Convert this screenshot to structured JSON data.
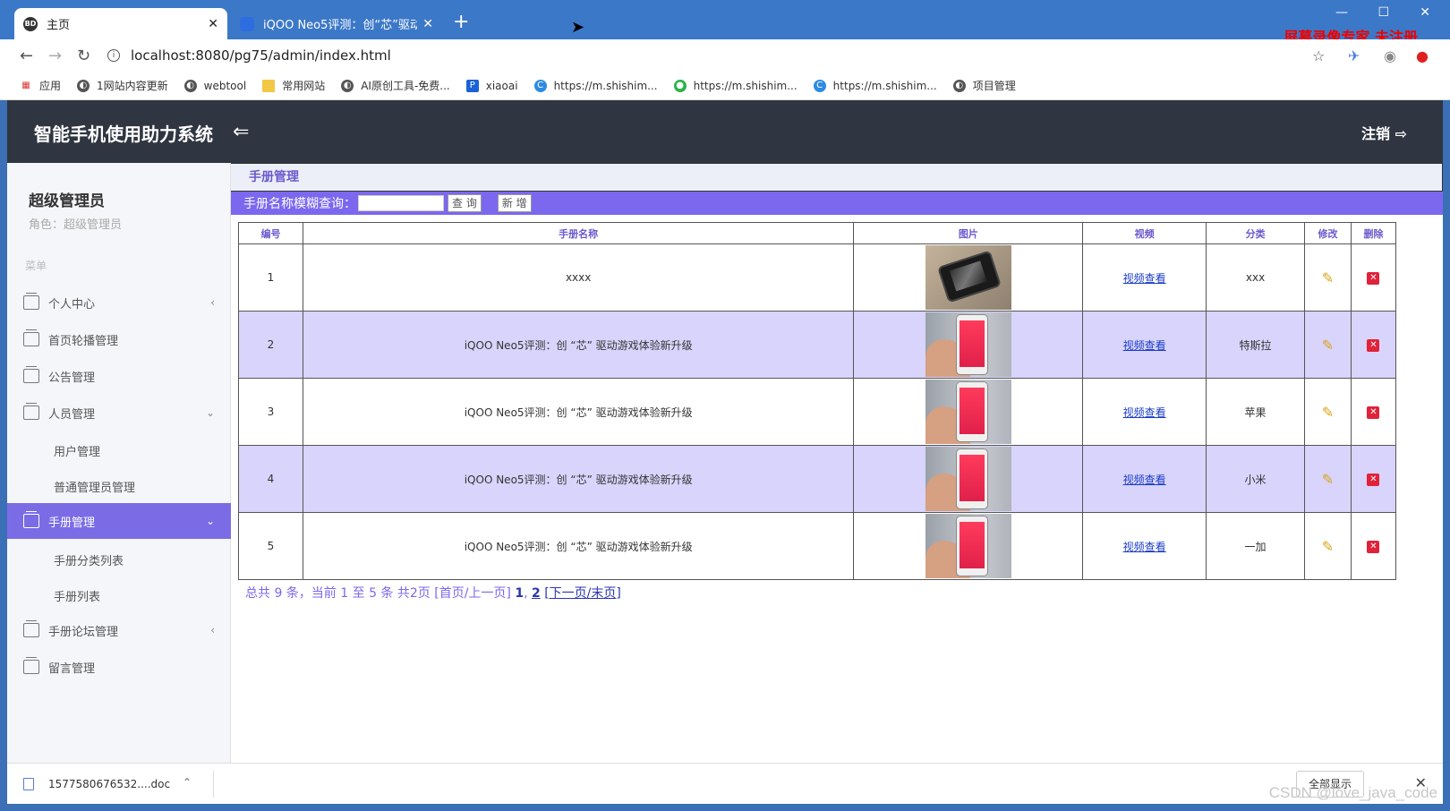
{
  "browser": {
    "tabs": [
      {
        "title": "主页",
        "favicon": "BD"
      },
      {
        "title": "iQOO Neo5评测：创“芯”驱动游..."
      }
    ],
    "url": "localhost:8080/pg75/admin/index.html",
    "watermark": "屏幕录像专家  未注册",
    "bookmarks": [
      {
        "label": "应用",
        "icon": "apps-grid-icon"
      },
      {
        "label": "1网站内容更新",
        "icon": "globe-icon"
      },
      {
        "label": "webtool",
        "icon": "globe-icon"
      },
      {
        "label": "常用网站",
        "icon": "folder-icon"
      },
      {
        "label": "AI原创工具-免费...",
        "icon": "globe-icon"
      },
      {
        "label": "xiaoai",
        "icon": "p-logo-icon"
      },
      {
        "label": "https://m.shishim...",
        "icon": "c-logo-icon"
      },
      {
        "label": "https://m.shishim...",
        "icon": "wechat-icon"
      },
      {
        "label": "https://m.shishim...",
        "icon": "c-logo-icon"
      },
      {
        "label": "项目管理",
        "icon": "globe-icon"
      }
    ]
  },
  "app": {
    "title": "智能手机使用助力系统",
    "logout": "注销"
  },
  "sidebar": {
    "user": "超级管理员",
    "role": "角色：超级管理员",
    "menu_heading": "菜单",
    "items": [
      {
        "label": "个人中心",
        "arrow": "‹"
      },
      {
        "label": "首页轮播管理"
      },
      {
        "label": "公告管理"
      },
      {
        "label": "人员管理",
        "arrow": "⌄"
      },
      {
        "label": "手册管理",
        "arrow": "⌄"
      },
      {
        "label": "手册论坛管理",
        "arrow": "‹"
      },
      {
        "label": "留言管理"
      }
    ],
    "sub_personnel": [
      "用户管理",
      "普通管理员管理"
    ],
    "sub_manual": [
      "手册分类列表",
      "手册列表"
    ]
  },
  "content": {
    "breadcrumb": "手册管理",
    "search_label": "手册名称模糊查询：",
    "search_value": "",
    "query_btn": "查 询",
    "add_btn": "新 增",
    "columns": [
      "编号",
      "手册名称",
      "图片",
      "视频",
      "分类",
      "修改",
      "删除"
    ],
    "rows": [
      {
        "id": "1",
        "name": "xxxx",
        "video": "视频查看",
        "category": "xxx",
        "image": "dark-phone"
      },
      {
        "id": "2",
        "name": "iQOO Neo5评测：创 “芯” 驱动游戏体验新升级",
        "video": "视频查看",
        "category": "特斯拉",
        "image": "red-phone"
      },
      {
        "id": "3",
        "name": "iQOO Neo5评测：创 “芯” 驱动游戏体验新升级",
        "video": "视频查看",
        "category": "苹果",
        "image": "red-phone"
      },
      {
        "id": "4",
        "name": "iQOO Neo5评测：创 “芯” 驱动游戏体验新升级",
        "video": "视频查看",
        "category": "小米",
        "image": "red-phone"
      },
      {
        "id": "5",
        "name": "iQOO Neo5评测：创 “芯” 驱动游戏体验新升级",
        "video": "视频查看",
        "category": "一加",
        "image": "red-phone"
      }
    ],
    "pager": {
      "summary": "总共 9 条，当前 1 至 5 条 共2页",
      "first_prev": "[首页/上一页]",
      "page1": "1",
      "page2": "2",
      "next_last": "[下一页/末页]"
    }
  },
  "downloads": {
    "file": "1577580676532....doc",
    "show_all": "全部显示"
  },
  "footer_watermark": "CSDN @love_java_code",
  "colors": {
    "accent": "#7b68ee",
    "header_bg": "#2f3541",
    "row_alt": "#d8d4fb",
    "browser_frame": "#3c78c8"
  }
}
